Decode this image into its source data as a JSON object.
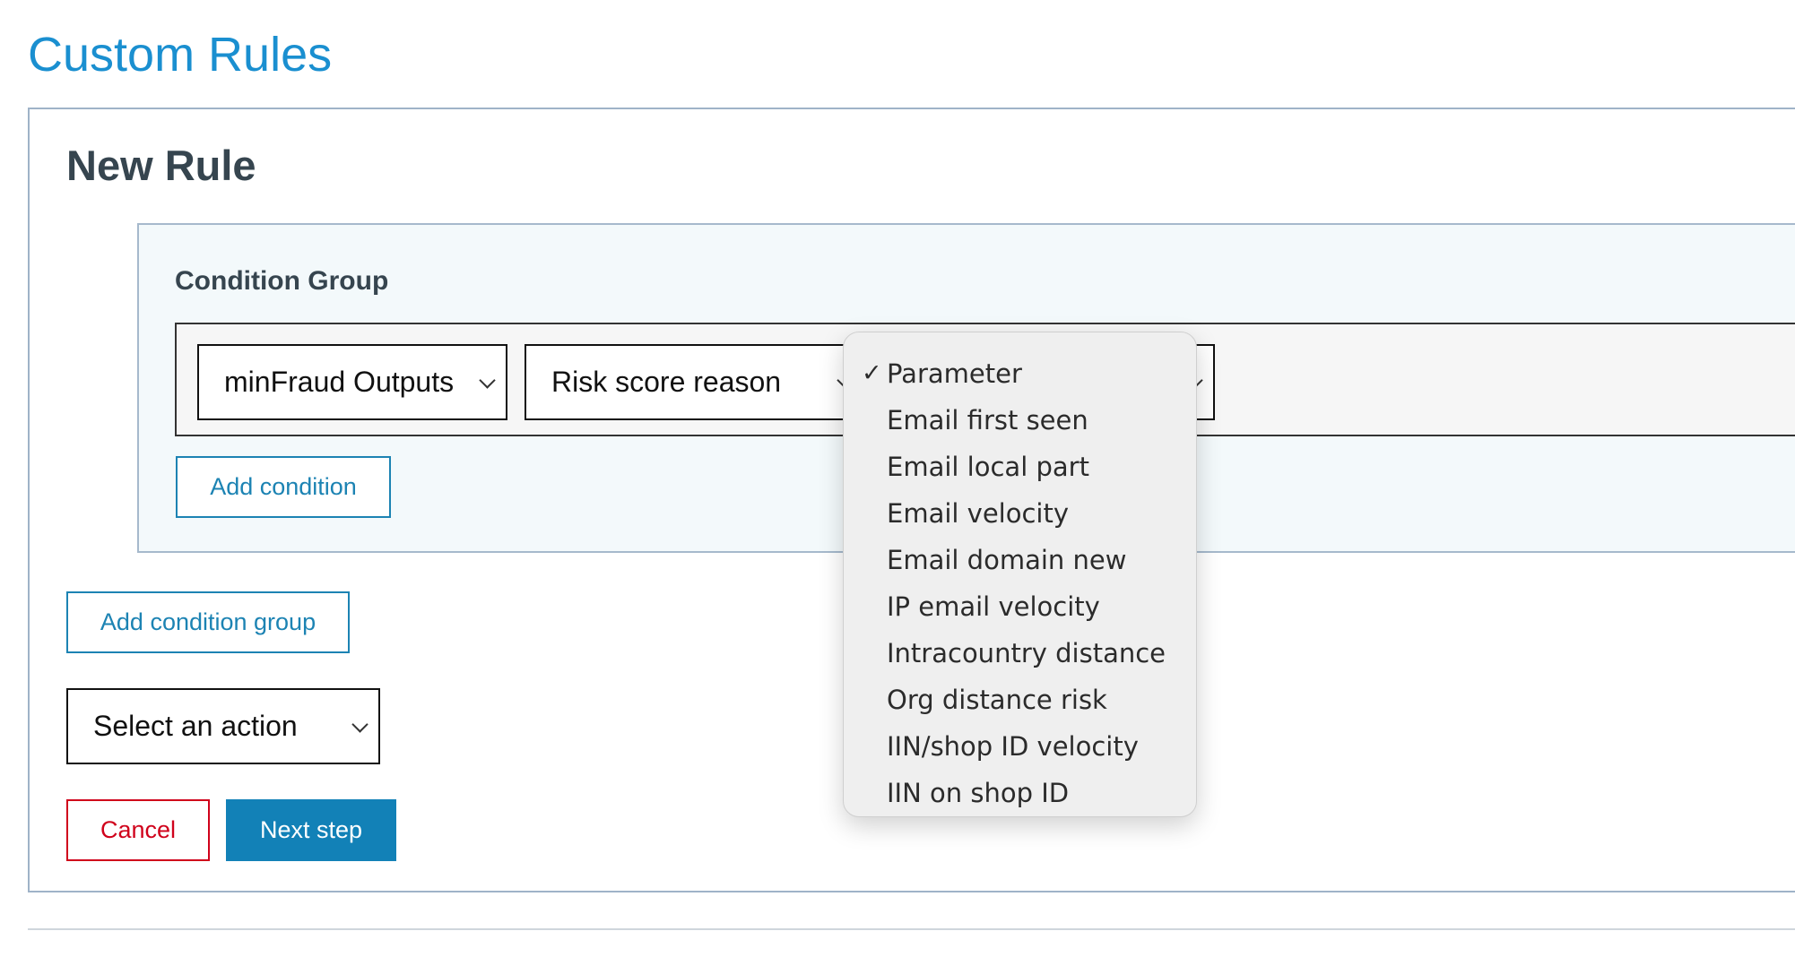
{
  "page": {
    "title": "Custom Rules"
  },
  "rule": {
    "heading": "New Rule"
  },
  "condition_group": {
    "title": "Condition Group",
    "selects": {
      "category": "minFraud Outputs",
      "field": "Risk score reason"
    },
    "add_condition_label": "Add condition"
  },
  "add_condition_group_label": "Add condition group",
  "action_select": {
    "value": "Select an action"
  },
  "buttons": {
    "cancel": "Cancel",
    "next": "Next step"
  },
  "dropdown": {
    "selected": "Parameter",
    "check_glyph": "✓",
    "options": [
      "Parameter",
      "Email first seen",
      "Email local part",
      "Email velocity",
      "Email domain new",
      "IP email velocity",
      "Intracountry distance",
      "Org distance risk",
      "IIN/shop ID velocity",
      "IIN on shop ID"
    ]
  },
  "colors": {
    "title_blue": "#1a8fd0",
    "primary_button": "#1281b7",
    "cancel_red": "#d0021b",
    "group_background": "#f3f9fb"
  }
}
